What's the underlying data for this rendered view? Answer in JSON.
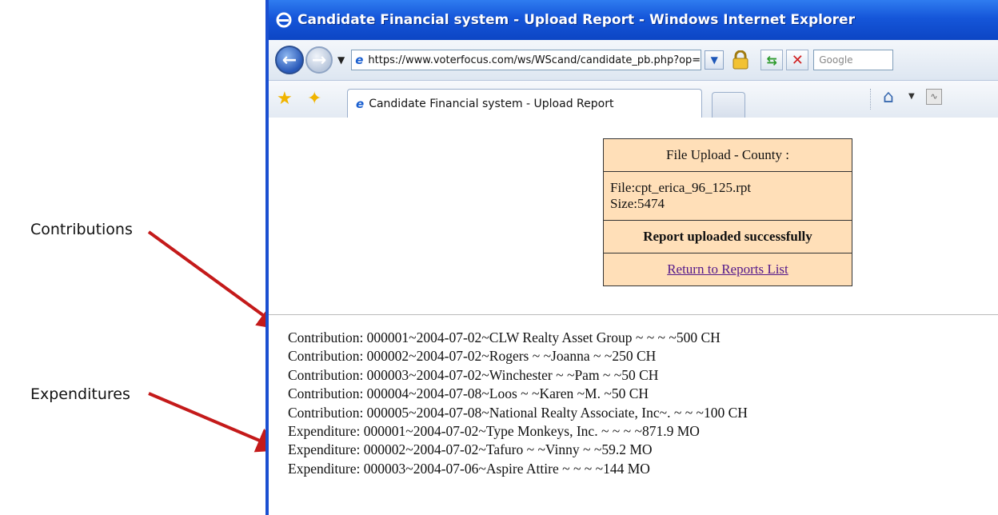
{
  "annotations": {
    "contributions": "Contributions",
    "expenditures": "Expenditures",
    "arrow_color": "#c41a1a"
  },
  "browser": {
    "title": "Candidate Financial system - Upload Report - Windows Internet Explorer",
    "address": "https://www.voterfocus.com/ws/WScand/candidate_pb.php?op=u",
    "search_placeholder": "Google",
    "tab_label": "Candidate Financial system - Upload Report",
    "icons": [
      "ie-icon",
      "back-icon",
      "forward-icon",
      "lock-icon",
      "refresh-icon",
      "stop-icon",
      "favorites-star-icon",
      "add-favorite-icon",
      "home-icon",
      "feed-icon"
    ]
  },
  "upload_box": {
    "header": "File Upload - County :",
    "file": "File:cpt_erica_96_125.rpt",
    "size": "Size:5474",
    "status": "Report uploaded successfully",
    "return_link": "Return to Reports List",
    "background": "#ffdfb8"
  },
  "records": [
    "Contribution: 000001~2004-07-02~CLW Realty Asset Group ~ ~ ~ ~500 CH",
    "Contribution: 000002~2004-07-02~Rogers ~ ~Joanna ~ ~250 CH",
    "Contribution: 000003~2004-07-02~Winchester ~ ~Pam ~ ~50 CH",
    "Contribution: 000004~2004-07-08~Loos ~ ~Karen ~M. ~50 CH",
    "Contribution: 000005~2004-07-08~National Realty Associate, Inc~. ~ ~ ~100 CH",
    "Expenditure: 000001~2004-07-02~Type Monkeys, Inc. ~ ~ ~ ~871.9 MO",
    "Expenditure: 000002~2004-07-02~Tafuro ~ ~Vinny ~ ~59.2 MO",
    "Expenditure: 000003~2004-07-06~Aspire Attire ~ ~ ~ ~144 MO"
  ]
}
